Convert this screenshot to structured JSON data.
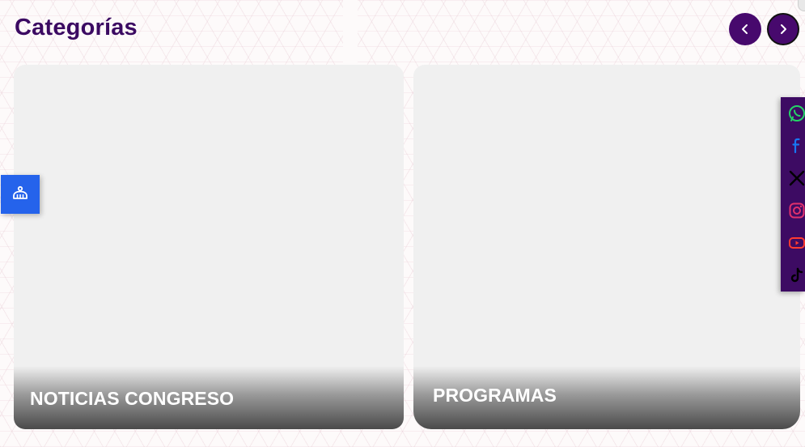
{
  "section": {
    "title": "Categorías"
  },
  "carousel": {
    "prev_icon": "chevron-left-icon",
    "next_icon": "chevron-right-icon",
    "cards": [
      {
        "label": "NOTICIAS CONGRESO"
      },
      {
        "label": "PROGRAMAS"
      }
    ]
  },
  "accessibility": {
    "icon": "accessibility-icon",
    "color": "#2563eb"
  },
  "social": {
    "items": [
      {
        "name": "whatsapp-icon",
        "color": "#25d366"
      },
      {
        "name": "facebook-icon",
        "color": "#1877f2"
      },
      {
        "name": "x-icon",
        "color": "#000000"
      },
      {
        "name": "instagram-icon",
        "color": "#e1306c"
      },
      {
        "name": "youtube-icon",
        "color": "#ff3b30"
      },
      {
        "name": "tiktok-icon",
        "color": "#000000"
      }
    ]
  },
  "colors": {
    "accent": "#47096d",
    "title": "#3b0a62"
  }
}
